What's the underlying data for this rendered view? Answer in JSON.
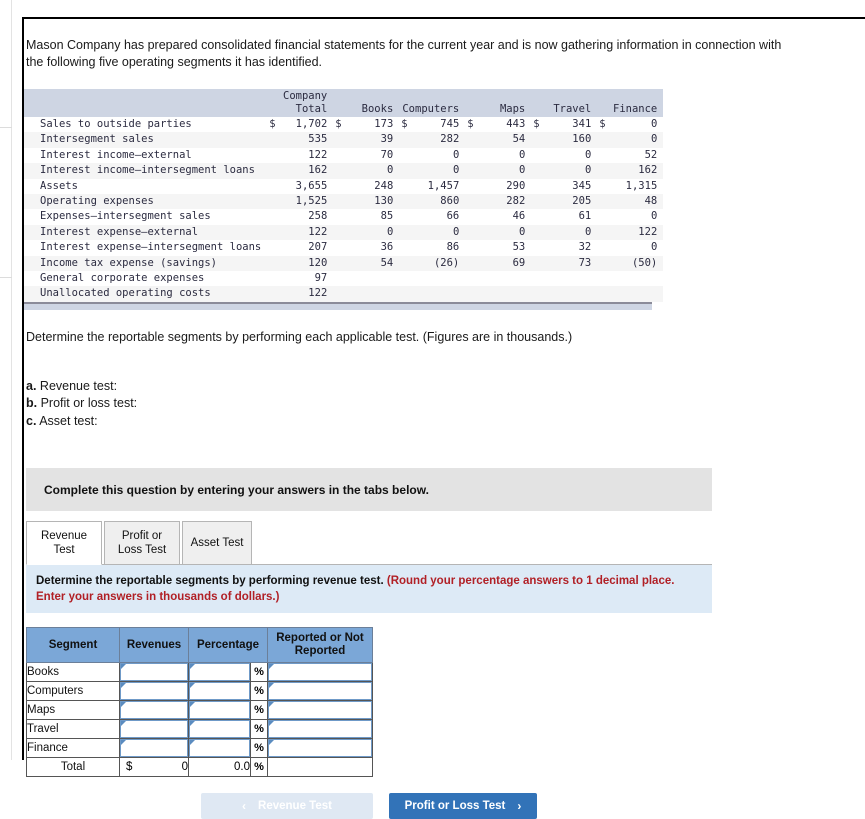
{
  "intro": {
    "text": "Mason Company has prepared consolidated financial statements for the current year and is now gathering information in connection with the following five operating segments it has identified."
  },
  "financial_table": {
    "columns": [
      "",
      "Company\nTotal",
      "Books",
      "Computers",
      "Maps",
      "Travel",
      "Finance"
    ],
    "rows": [
      {
        "label": "Sales to outside parties",
        "values": [
          "$ 1,702",
          "$ 173",
          "$  745",
          "$ 443",
          "$ 341",
          "$    0"
        ]
      },
      {
        "label": "Intersegment sales",
        "values": [
          "535",
          "39",
          "282",
          "54",
          "160",
          "0"
        ]
      },
      {
        "label": "Interest income—external",
        "values": [
          "122",
          "70",
          "0",
          "0",
          "0",
          "52"
        ]
      },
      {
        "label": "Interest income—intersegment loans",
        "values": [
          "162",
          "0",
          "0",
          "0",
          "0",
          "162"
        ]
      },
      {
        "label": "Assets",
        "values": [
          "3,655",
          "248",
          "1,457",
          "290",
          "345",
          "1,315"
        ]
      },
      {
        "label": "Operating expenses",
        "values": [
          "1,525",
          "130",
          "860",
          "282",
          "205",
          "48"
        ]
      },
      {
        "label": "Expenses—intersegment sales",
        "values": [
          "258",
          "85",
          "66",
          "46",
          "61",
          "0"
        ]
      },
      {
        "label": "Interest expense—external",
        "values": [
          "122",
          "0",
          "0",
          "0",
          "0",
          "122"
        ]
      },
      {
        "label": "Interest expense—intersegment loans",
        "values": [
          "207",
          "36",
          "86",
          "53",
          "32",
          "0"
        ]
      },
      {
        "label": "Income tax expense (savings)",
        "values": [
          "120",
          "54",
          "(26)",
          "69",
          "73",
          "(50)"
        ]
      },
      {
        "label": "General corporate expenses",
        "values": [
          "97",
          "",
          "",
          "",
          "",
          ""
        ]
      },
      {
        "label": "Unallocated operating costs",
        "values": [
          "122",
          "",
          "",
          "",
          "",
          ""
        ]
      }
    ]
  },
  "determine": {
    "text": "Determine the reportable segments by performing each applicable test. (Figures are in thousands.)"
  },
  "abc_list": [
    {
      "letter": "a.",
      "text": "Revenue test:"
    },
    {
      "letter": "b.",
      "text": "Profit or loss test:"
    },
    {
      "letter": "c.",
      "text": "Asset test:"
    }
  ],
  "gray_banner": {
    "text": "Complete this question by entering your answers in the tabs below."
  },
  "tabs": [
    {
      "label": "Revenue Test",
      "active": true
    },
    {
      "label": "Profit or Loss Test",
      "active": false
    },
    {
      "label": "Asset Test",
      "active": false
    }
  ],
  "blue_instruction": {
    "black_part": "Determine the reportable segments by performing revenue test. ",
    "red_part": "(Round your percentage answers to 1 decimal place. Enter your answers in thousands of dollars.)"
  },
  "answer_table": {
    "headers": [
      "Segment",
      "Revenues",
      "Percentage",
      "Reported or Not Reported"
    ],
    "rows": [
      {
        "segment": "Books",
        "revenues": "",
        "percentage": "",
        "pct_symbol": "%",
        "reported": ""
      },
      {
        "segment": "Computers",
        "revenues": "",
        "percentage": "",
        "pct_symbol": "%",
        "reported": ""
      },
      {
        "segment": "Maps",
        "revenues": "",
        "percentage": "",
        "pct_symbol": "%",
        "reported": ""
      },
      {
        "segment": "Travel",
        "revenues": "",
        "percentage": "",
        "pct_symbol": "%",
        "reported": ""
      },
      {
        "segment": "Finance",
        "revenues": "",
        "percentage": "",
        "pct_symbol": "%",
        "reported": ""
      }
    ],
    "total": {
      "label": "Total",
      "dollar": "$",
      "revenues": "0",
      "percentage": "0.0",
      "pct_symbol": "%",
      "reported": ""
    }
  },
  "nav": {
    "prev_label": "Revenue Test",
    "prev_icon": "chevron-left-icon",
    "prev_chevron": "‹",
    "next_label": "Profit or Loss Test",
    "next_icon": "chevron-right-icon",
    "next_chevron": "›"
  },
  "colors": {
    "accent_blue": "#3273b8",
    "header_blue": "#7ba7d7",
    "fin_header": "#ced5e3",
    "instruction_blue": "#ddeaf6",
    "red_text": "#b12026"
  }
}
